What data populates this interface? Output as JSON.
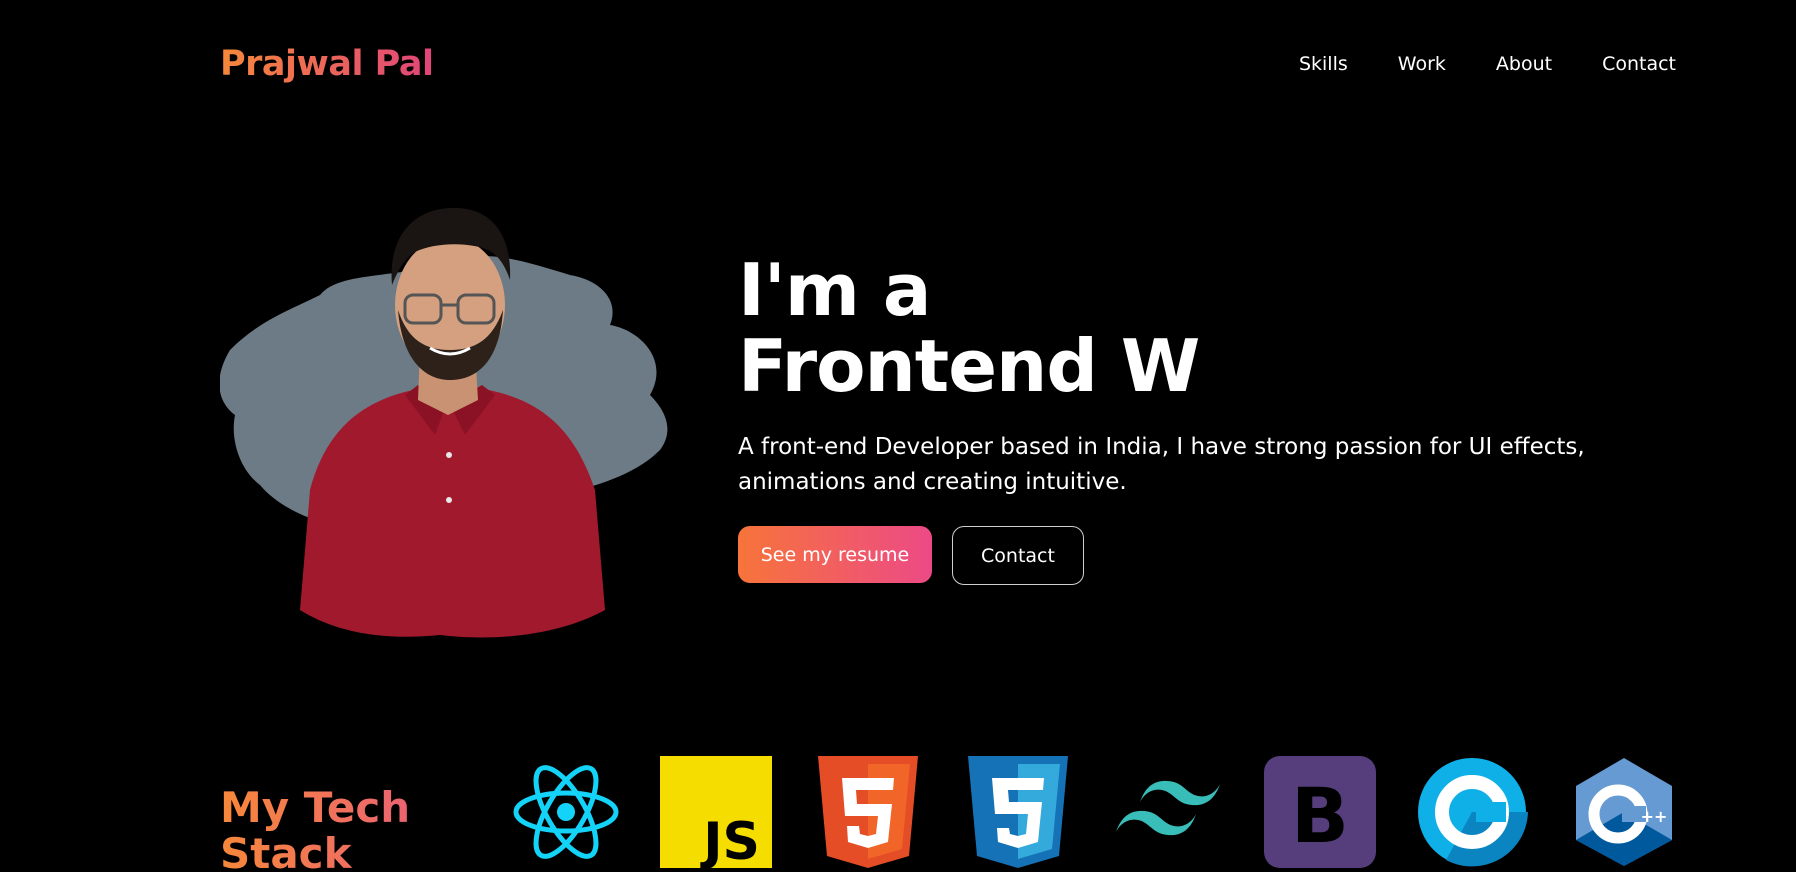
{
  "header": {
    "brand": "Prajwal Pal",
    "nav": [
      "Skills",
      "Work",
      "About",
      "Contact"
    ]
  },
  "hero": {
    "title_line1": "I'm a",
    "title_line2": "Frontend W",
    "description": "A front-end Developer based in India, I have strong passion for UI effects, animations and creating intuitive.",
    "primary_button": "See my resume",
    "secondary_button": "Contact"
  },
  "tech_stack": {
    "title": "My Tech Stack",
    "icons": [
      "react-icon",
      "javascript-icon",
      "html5-icon",
      "css3-icon",
      "tailwind-icon",
      "bootstrap-icon",
      "c-icon",
      "cpp-icon"
    ]
  },
  "colors": {
    "background": "#000000",
    "accent_start": "#f7883a",
    "accent_end": "#e0447a",
    "brush": "#6c7b86",
    "shirt": "#a0192c"
  }
}
